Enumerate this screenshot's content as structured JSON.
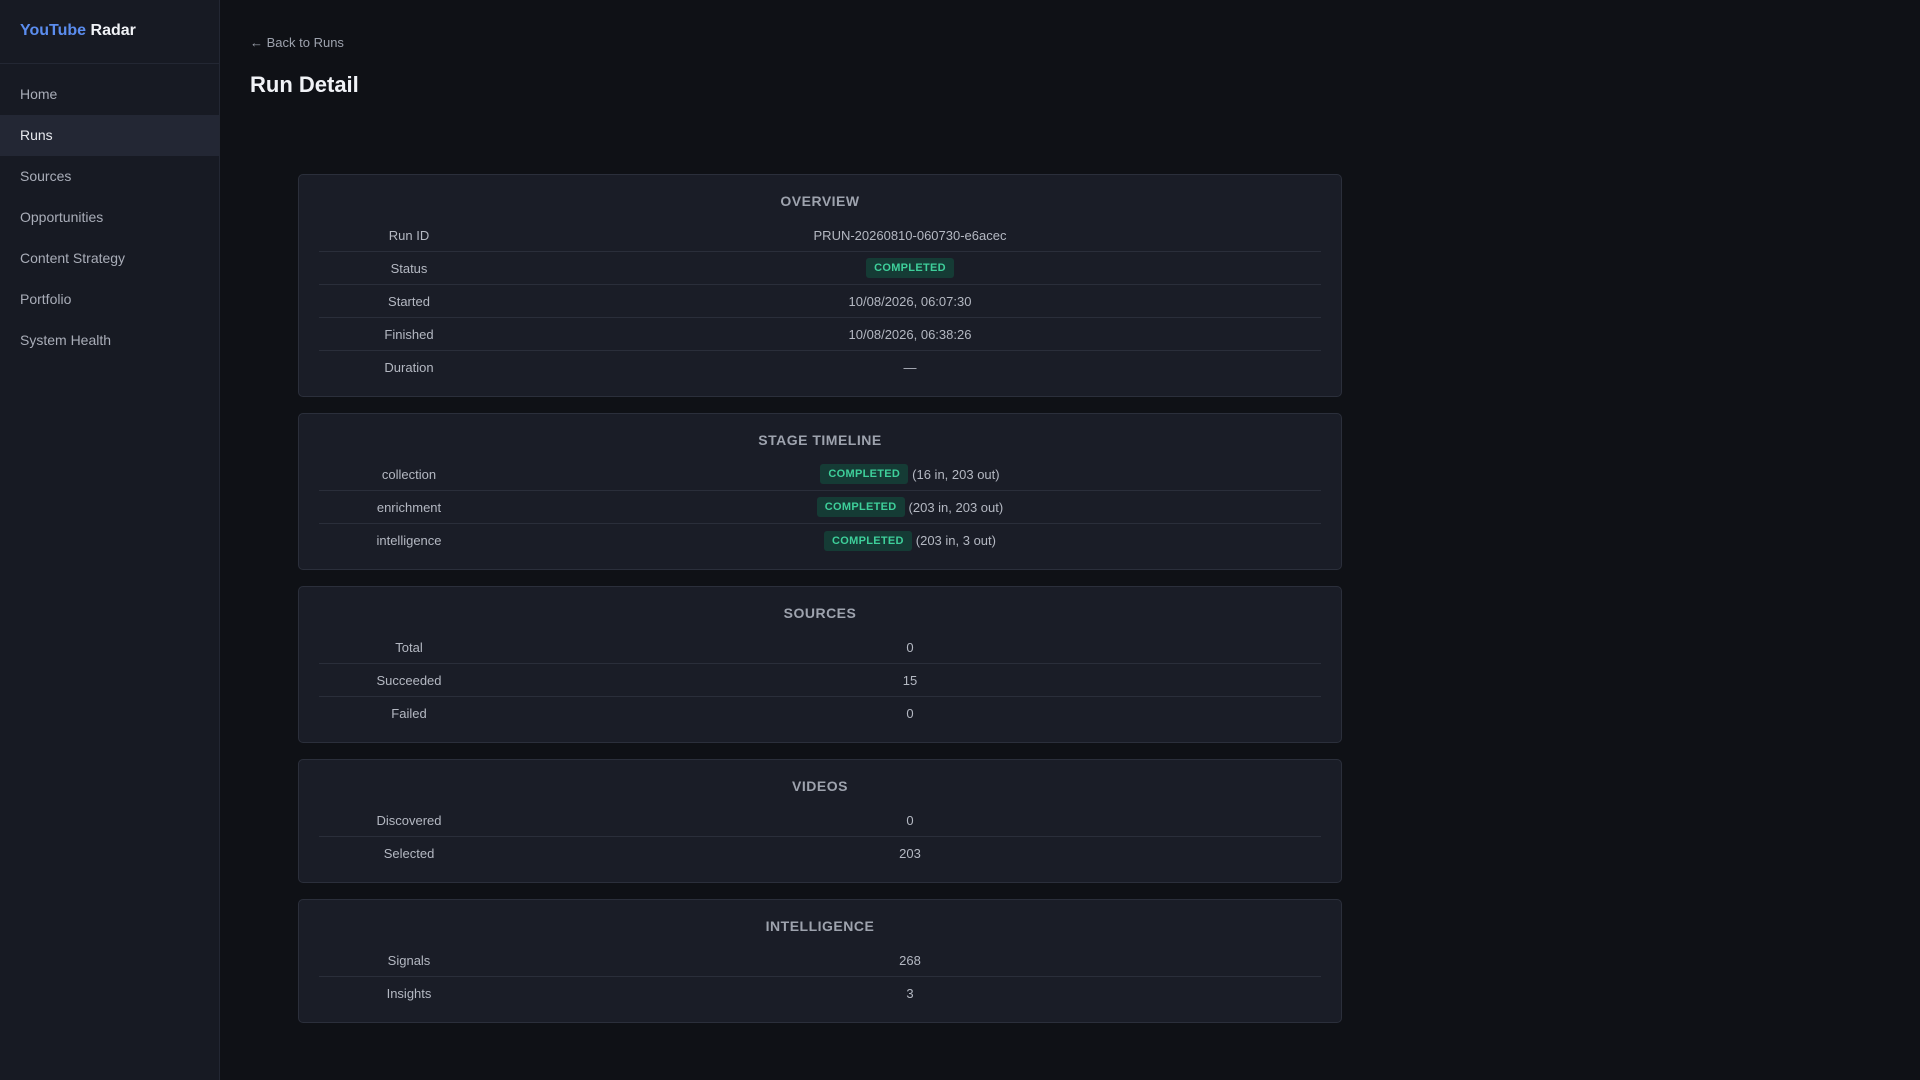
{
  "brand": {
    "part1": "YouTube",
    "part2": "Radar",
    "accent": "#5b8def"
  },
  "nav": {
    "items": [
      {
        "label": "Home"
      },
      {
        "label": "Runs",
        "active": true
      },
      {
        "label": "Sources"
      },
      {
        "label": "Opportunities"
      },
      {
        "label": "Content Strategy"
      },
      {
        "label": "Portfolio"
      },
      {
        "label": "System Health"
      }
    ]
  },
  "header": {
    "back_label": "← Back to Runs",
    "title": "Run Detail"
  },
  "overview": {
    "title": "OVERVIEW",
    "rows": [
      {
        "label": "Run ID",
        "value": "PRUN-20260810-060730-e6acec"
      },
      {
        "label": "Status",
        "badge": "COMPLETED"
      },
      {
        "label": "Started",
        "value": "10/08/2026, 06:07:30"
      },
      {
        "label": "Finished",
        "value": "10/08/2026, 06:38:26"
      },
      {
        "label": "Duration",
        "value": "—"
      }
    ]
  },
  "stages": {
    "title": "STAGE TIMELINE",
    "rows": [
      {
        "label": "collection",
        "badge": "COMPLETED",
        "note": "(16 in, 203 out)"
      },
      {
        "label": "enrichment",
        "badge": "COMPLETED",
        "note": "(203 in, 203 out)"
      },
      {
        "label": "intelligence",
        "badge": "COMPLETED",
        "note": "(203 in, 3 out)"
      }
    ]
  },
  "sources": {
    "title": "SOURCES",
    "rows": [
      {
        "label": "Total",
        "value": "0"
      },
      {
        "label": "Succeeded",
        "value": "15"
      },
      {
        "label": "Failed",
        "value": "0"
      }
    ]
  },
  "videos": {
    "title": "VIDEOS",
    "rows": [
      {
        "label": "Discovered",
        "value": "0"
      },
      {
        "label": "Selected",
        "value": "203"
      }
    ]
  },
  "intelligence": {
    "title": "INTELLIGENCE",
    "rows": [
      {
        "label": "Signals",
        "value": "268"
      },
      {
        "label": "Insights",
        "value": "3"
      }
    ]
  },
  "colors": {
    "badge_bg": "#153b35",
    "badge_text": "#3ecf9a"
  }
}
